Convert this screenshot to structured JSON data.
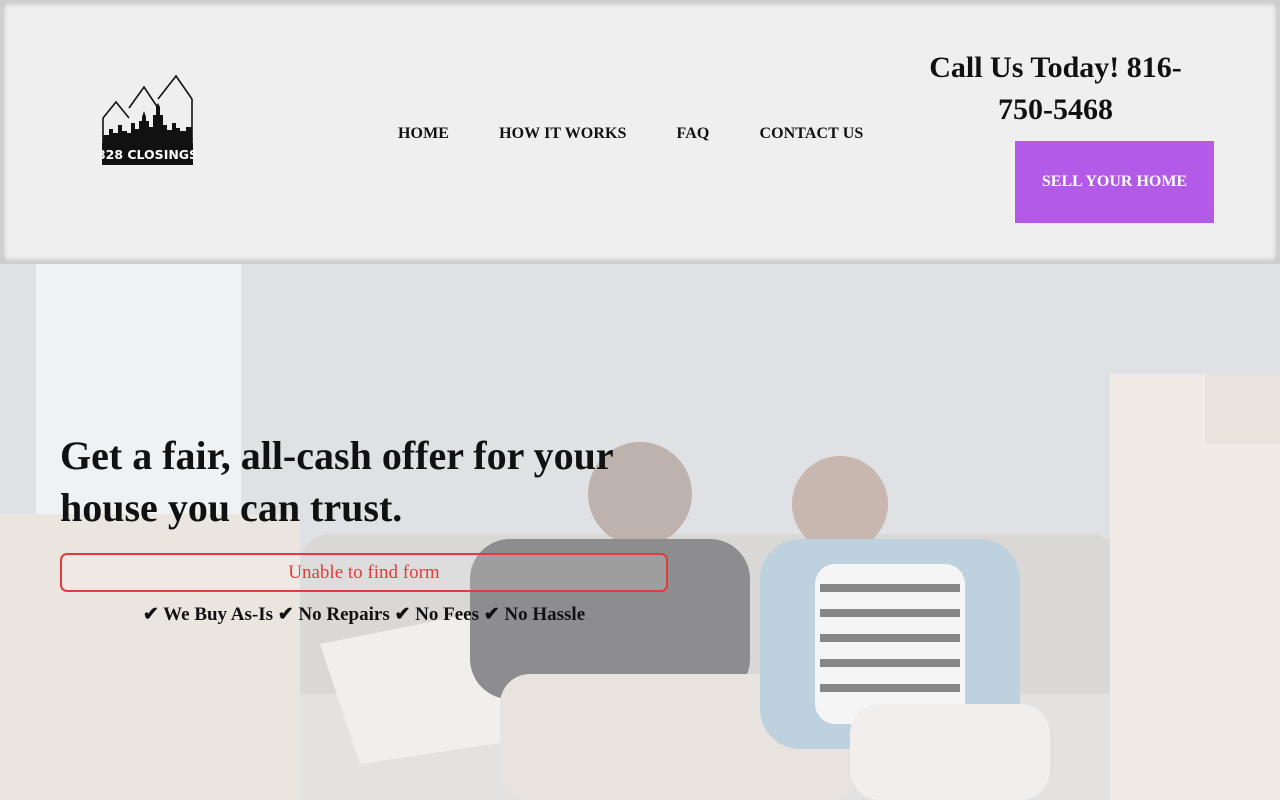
{
  "brand": {
    "logo_text": "828 CLOSINGS"
  },
  "nav": {
    "items": [
      {
        "label": "HOME"
      },
      {
        "label": "HOW IT WORKS"
      },
      {
        "label": "FAQ"
      },
      {
        "label": "CONTACT US"
      }
    ]
  },
  "header": {
    "call_text": "Call Us Today! 816-750-5468",
    "cta_label": "SELL YOUR HOME"
  },
  "hero": {
    "headline": "Get a fair, all-cash offer for your house you can trust.",
    "form_error": "Unable to find form",
    "benefits": "✔ We Buy As-Is ✔ No Repairs ✔ No Fees ✔ No Hassle"
  },
  "colors": {
    "accent": "#b35ae9",
    "error": "#e23b3b",
    "header_bg": "#efefef",
    "text": "#111111"
  },
  "icons": {
    "logo": "house-skyline-logo-icon"
  }
}
